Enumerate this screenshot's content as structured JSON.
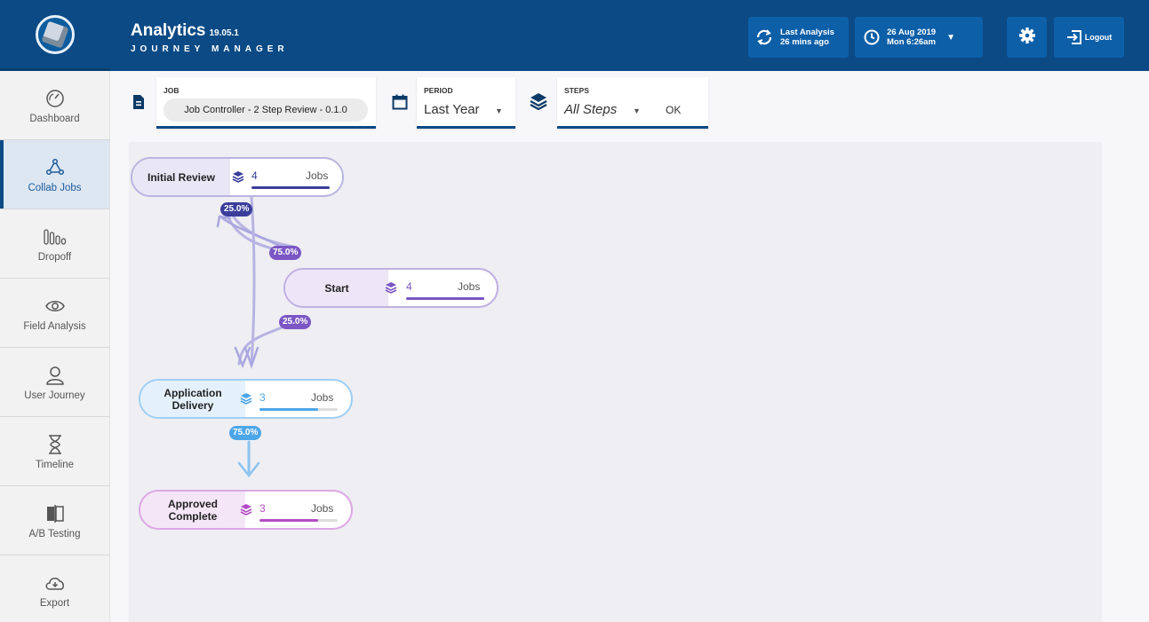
{
  "header": {
    "app_name": "Analytics",
    "version": "19.05.1",
    "subtitle": "JOURNEY MANAGER",
    "last_analysis_label": "Last Analysis",
    "last_analysis_value": "26 mins ago",
    "date_line1": "26 Aug 2019",
    "date_line2": "Mon 6:26am",
    "logout_label": "Logout"
  },
  "sidebar": {
    "items": [
      {
        "label": "Dashboard",
        "icon": "speedometer-icon"
      },
      {
        "label": "Collab Jobs",
        "icon": "collab-icon",
        "active": true
      },
      {
        "label": "Dropoff",
        "icon": "dropoff-icon"
      },
      {
        "label": "Field Analysis",
        "icon": "eye-icon"
      },
      {
        "label": "User Journey",
        "icon": "user-icon"
      },
      {
        "label": "Timeline",
        "icon": "hourglass-icon"
      },
      {
        "label": "A/B Testing",
        "icon": "ab-testing-icon"
      },
      {
        "label": "Export",
        "icon": "cloud-download-icon"
      }
    ]
  },
  "filters": {
    "job_label": "JOB",
    "job_value": "Job Controller - 2 Step Review - 0.1.0",
    "period_label": "PERIOD",
    "period_value": "Last Year",
    "steps_label": "STEPS",
    "steps_value": "All Steps",
    "ok_label": "OK"
  },
  "flow": {
    "jobs_label": "Jobs",
    "nodes": [
      {
        "name": "Initial Review",
        "count": "4",
        "color": "#3a3e9a",
        "bar_fraction": 1.0
      },
      {
        "name": "Start",
        "count": "4",
        "color": "#7b56c4",
        "bar_fraction": 1.0
      },
      {
        "name": "Application Delivery",
        "line1": "Application",
        "line2": "Delivery",
        "count": "3",
        "color": "#4da6e8",
        "bar_fraction": 0.75
      },
      {
        "name": "Approved Complete",
        "line1": "Approved",
        "line2": "Complete",
        "count": "3",
        "color": "#b44cc4",
        "bar_fraction": 0.75
      }
    ],
    "badges": [
      {
        "text": "25.0%",
        "color": "#3a3e9a"
      },
      {
        "text": "75.0%",
        "color": "#7b56c4"
      },
      {
        "text": "25.0%",
        "color": "#7b56c4"
      },
      {
        "text": "75.0%",
        "color": "#4da6e8"
      }
    ]
  },
  "colors": {
    "header_bg": "#0b4a85",
    "accent": "#0d5fa8"
  }
}
